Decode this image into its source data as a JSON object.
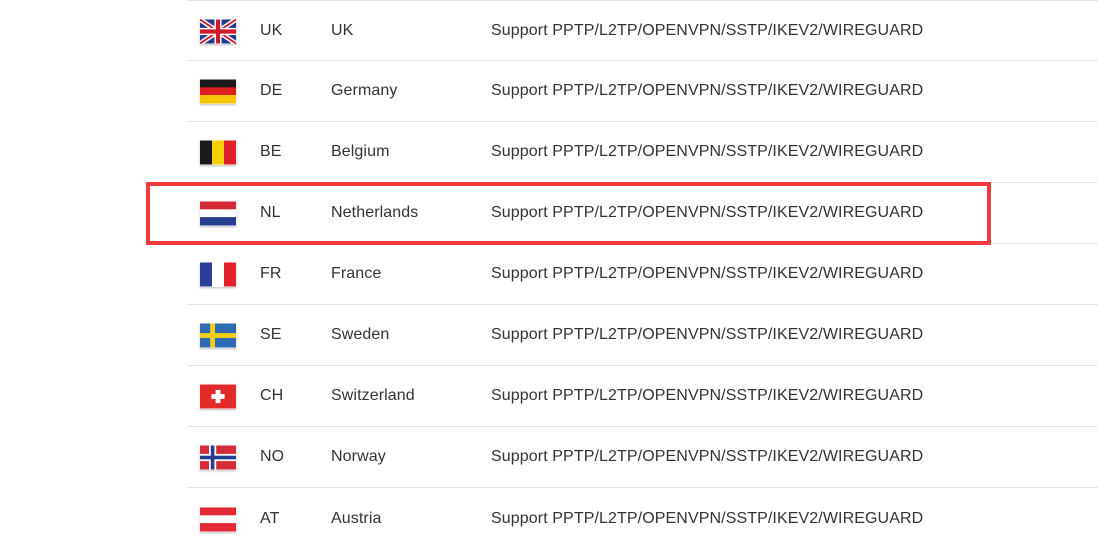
{
  "servers": [
    {
      "flag": "uk-flag-icon",
      "code": "UK",
      "name": "UK",
      "support": "Support PPTP/L2TP/OPENVPN/SSTP/IKEV2/WIREGUARD"
    },
    {
      "flag": "germany-flag-icon",
      "code": "DE",
      "name": "Germany",
      "support": "Support PPTP/L2TP/OPENVPN/SSTP/IKEV2/WIREGUARD"
    },
    {
      "flag": "belgium-flag-icon",
      "code": "BE",
      "name": "Belgium",
      "support": "Support PPTP/L2TP/OPENVPN/SSTP/IKEV2/WIREGUARD"
    },
    {
      "flag": "netherlands-flag-icon",
      "code": "NL",
      "name": "Netherlands",
      "support": "Support PPTP/L2TP/OPENVPN/SSTP/IKEV2/WIREGUARD"
    },
    {
      "flag": "france-flag-icon",
      "code": "FR",
      "name": "France",
      "support": "Support PPTP/L2TP/OPENVPN/SSTP/IKEV2/WIREGUARD"
    },
    {
      "flag": "sweden-flag-icon",
      "code": "SE",
      "name": "Sweden",
      "support": "Support PPTP/L2TP/OPENVPN/SSTP/IKEV2/WIREGUARD"
    },
    {
      "flag": "switzerland-flag-icon",
      "code": "CH",
      "name": "Switzerland",
      "support": "Support PPTP/L2TP/OPENVPN/SSTP/IKEV2/WIREGUARD"
    },
    {
      "flag": "norway-flag-icon",
      "code": "NO",
      "name": "Norway",
      "support": "Support PPTP/L2TP/OPENVPN/SSTP/IKEV2/WIREGUARD"
    },
    {
      "flag": "austria-flag-icon",
      "code": "AT",
      "name": "Austria",
      "support": "Support PPTP/L2TP/OPENVPN/SSTP/IKEV2/WIREGUARD"
    }
  ],
  "highlighted_row": "NL",
  "colors": {
    "highlight_border": "#f03b3d",
    "text": "#333333",
    "row_divider": "#e4e4e4"
  }
}
